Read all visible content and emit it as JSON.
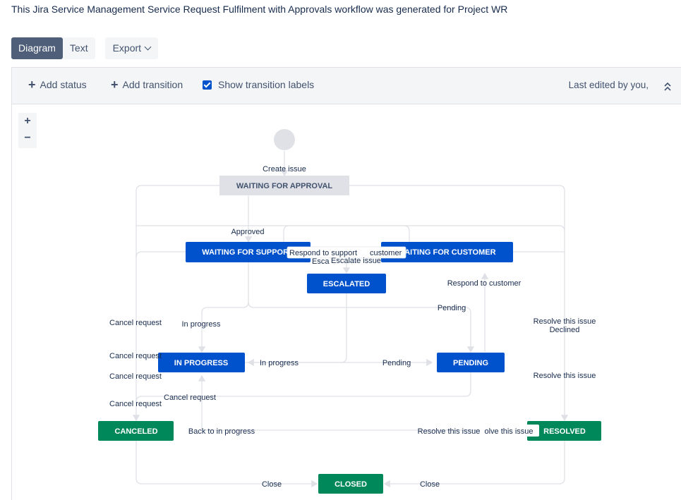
{
  "intro_text": "This Jira Service Management Service Request Fulfilment with Approvals workflow was generated for Project WR",
  "tabs": {
    "diagram": "Diagram",
    "text": "Text",
    "export": "Export"
  },
  "toolbar": {
    "add_status": "Add status",
    "add_transition": "Add transition",
    "show_labels": "Show transition labels",
    "last_edited": "Last edited by you,"
  },
  "zoom": {
    "in": "+",
    "out": "−"
  },
  "colors": {
    "blue": "#0052cc",
    "green": "#00875a",
    "grey": "#dfe1e6",
    "line": "#dfe1e6"
  },
  "statuses": {
    "waiting_for_approval": "WAITING FOR APPROVAL",
    "waiting_for_support": "WAITING FOR SUPPORT",
    "waiting_for_customer": "WAITING FOR CUSTOMER",
    "escalated": "ESCALATED",
    "in_progress": "IN PROGRESS",
    "pending": "PENDING",
    "canceled": "CANCELED",
    "resolved": "RESOLVED",
    "closed": "CLOSED"
  },
  "transitions": {
    "create_issue": "Create issue",
    "approved": "Approved",
    "respond_to_support": "Respond to support",
    "respond_to_customer_inline": "customer",
    "escalate_left": "Esca",
    "escalate": "Escalate issue",
    "respond_to_customer": "Respond to customer",
    "pending_top": "Pending",
    "cancel_request_1": "Cancel request",
    "in_progress_1": "In progress",
    "resolve_declined": "Resolve this issue",
    "declined": "Declined",
    "cancel_request_2": "Cancel request",
    "in_progress_2": "In progress",
    "pending_mid": "Pending",
    "cancel_request_3": "Cancel request",
    "resolve_this_issue_1": "Resolve this issue",
    "cancel_request_4": "Cancel request",
    "cancel_request_5": "Cancel request",
    "back_to_in_progress": "Back to in progress",
    "resolve_this_issue_2": "Resolve this issue",
    "resolve_this_issue_3": "olve this issue",
    "close_left": "Close",
    "close_right": "Close"
  }
}
